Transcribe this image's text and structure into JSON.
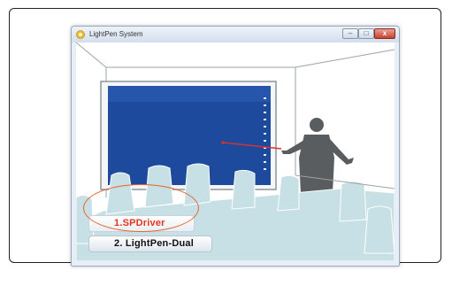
{
  "window": {
    "title": "LightPen System",
    "controls": {
      "minimize": "–",
      "maximize": "□",
      "close": "x"
    }
  },
  "menu": {
    "items": [
      {
        "label": "1.SPDriver"
      },
      {
        "label": "2. LightPen-Dual"
      }
    ]
  },
  "colors": {
    "screen": "#1e4a9e",
    "highlight": "#e7642a",
    "scene": "#c6e0e5"
  }
}
